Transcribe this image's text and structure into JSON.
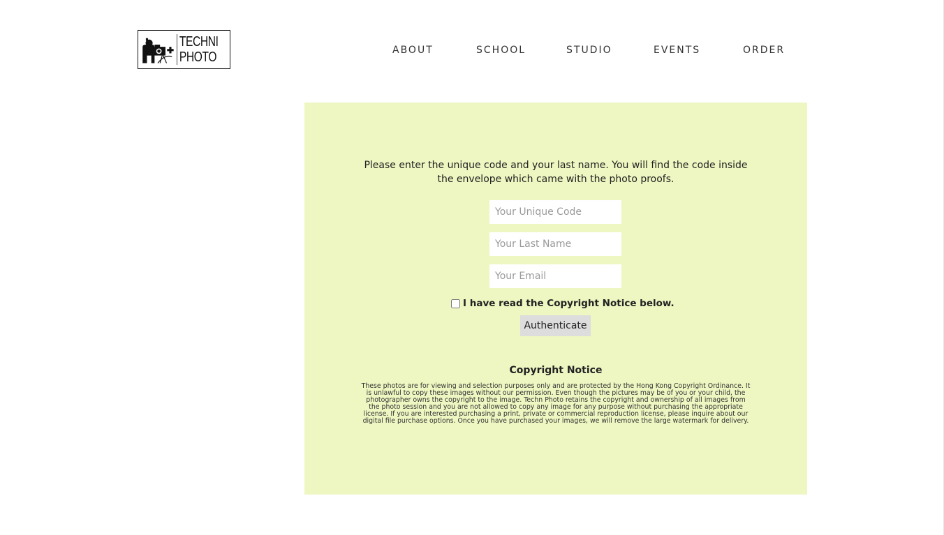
{
  "header": {
    "logo": {
      "line1": "TECHNI",
      "line2": "PHOTO",
      "icon": "photographer-with-camera-icon"
    },
    "nav": [
      {
        "label": "ABOUT"
      },
      {
        "label": "SCHOOL"
      },
      {
        "label": "STUDIO"
      },
      {
        "label": "EVENTS"
      },
      {
        "label": "ORDER"
      }
    ]
  },
  "form": {
    "instructions": "Please enter the unique code and your last name. You will find the code inside the envelope which came with the photo proofs.",
    "code_placeholder": "Your Unique Code",
    "code_value": "",
    "last_name_placeholder": "Your Last Name",
    "last_name_value": "",
    "email_placeholder": "Your Email",
    "email_value": "",
    "checkbox_label": "I have read the Copyright Notice below.",
    "checkbox_checked": false,
    "submit_label": "Authenticate"
  },
  "copyright": {
    "title": "Copyright Notice",
    "body": "These photos are for viewing and selection purposes only and are protected by the Hong Kong Copyright Ordinance. It is unlawful to copy these images without our permission. Even though the pictures may be of you or your child, the photographer owns the copyright to the image. Techn Photo retains the copyright and ownership of all images from the photo session and you are not allowed to copy any image for any purpose without purchasing the appropriate license. If you are interested purchasing a print, private or commercial reproduction license, please inquire about our digital file purchase options. Once you have purchased your images, we will remove the large watermark for delivery."
  },
  "colors": {
    "panel_background": "#eef6c1",
    "button_background": "#dddddd",
    "nav_text": "#333333"
  }
}
